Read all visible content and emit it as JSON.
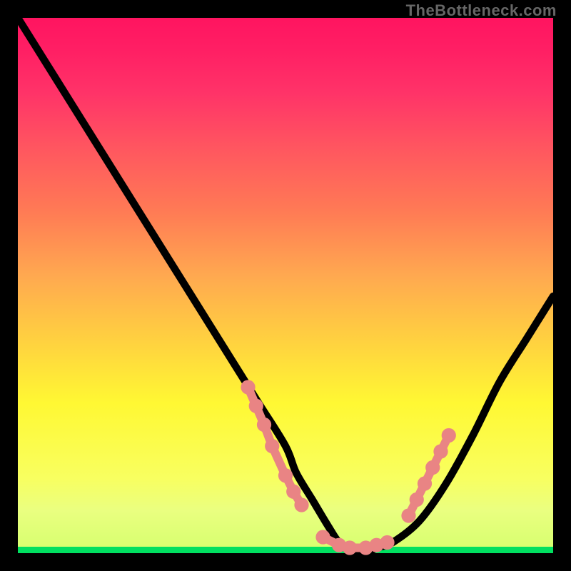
{
  "watermark": "TheBottleneck.com",
  "chart_data": {
    "type": "line",
    "title": "",
    "xlabel": "",
    "ylabel": "",
    "xlim": [
      0,
      100
    ],
    "ylim": [
      0,
      100
    ],
    "grid": false,
    "legend": false,
    "series": [
      {
        "name": "bottleneck-curve",
        "x": [
          0,
          5,
          10,
          15,
          20,
          25,
          30,
          35,
          40,
          45,
          50,
          52,
          55,
          58,
          60,
          62,
          65,
          67,
          70,
          75,
          80,
          85,
          90,
          95,
          100
        ],
        "y": [
          100,
          92,
          84,
          76,
          68,
          60,
          52,
          44,
          36,
          28,
          20,
          15,
          10,
          5,
          2,
          1,
          0,
          1,
          2,
          6,
          13,
          22,
          32,
          40,
          48
        ]
      }
    ],
    "highlight_clusters": [
      {
        "name": "left-descent",
        "points": [
          [
            43,
            31
          ],
          [
            44.5,
            27.5
          ],
          [
            46,
            24
          ],
          [
            47.5,
            20
          ],
          [
            50,
            14.5
          ],
          [
            51.5,
            11.5
          ],
          [
            53,
            9
          ]
        ]
      },
      {
        "name": "trough",
        "points": [
          [
            57,
            3
          ],
          [
            60,
            1.5
          ],
          [
            62,
            1
          ],
          [
            65,
            1
          ],
          [
            67,
            1.5
          ],
          [
            69,
            2
          ]
        ]
      },
      {
        "name": "right-ascent",
        "points": [
          [
            73,
            7
          ],
          [
            74.5,
            10
          ],
          [
            76,
            13
          ],
          [
            77.5,
            16
          ],
          [
            79,
            19
          ],
          [
            80.5,
            22
          ]
        ]
      }
    ],
    "background_gradient": {
      "stops": [
        {
          "pos": 0,
          "color": "#00e060"
        },
        {
          "pos": 1.2,
          "color": "#d8ff70"
        },
        {
          "pos": 14,
          "color": "#f8ff60"
        },
        {
          "pos": 28,
          "color": "#fff833"
        },
        {
          "pos": 52,
          "color": "#ffa850"
        },
        {
          "pos": 76,
          "color": "#ff5560"
        },
        {
          "pos": 100,
          "color": "#ff1460"
        }
      ]
    }
  }
}
